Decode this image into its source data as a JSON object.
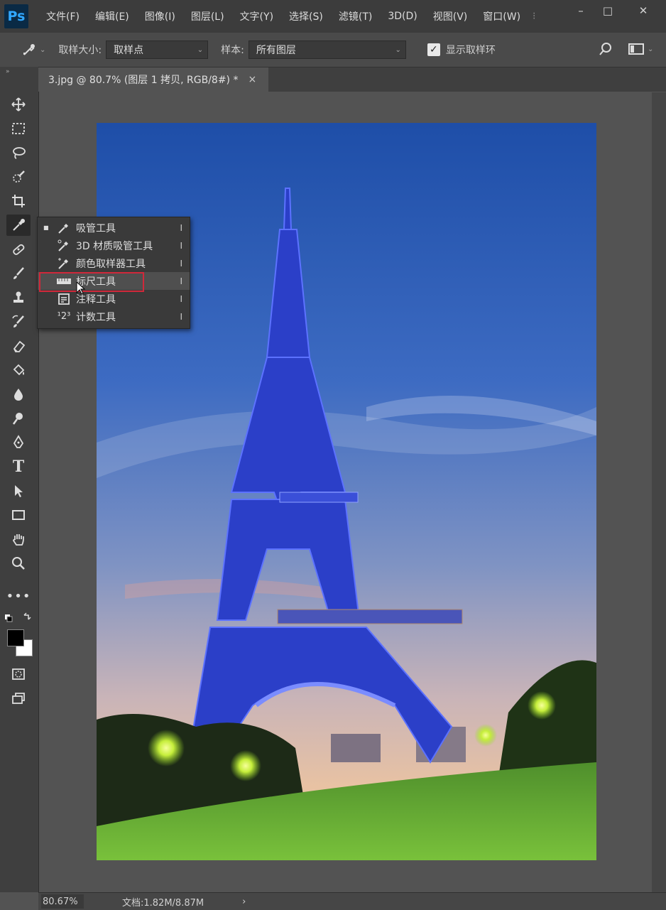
{
  "app": {
    "logo": "Ps"
  },
  "menu": [
    "文件(F)",
    "编辑(E)",
    "图像(I)",
    "图层(L)",
    "文字(Y)",
    "选择(S)",
    "滤镜(T)",
    "3D(D)",
    "视图(V)",
    "窗口(W)"
  ],
  "window_controls": {
    "minimize": "–",
    "maximize": "□",
    "close": "✕"
  },
  "options": {
    "sample_size_label": "取样大小:",
    "sample_size_value": "取样点",
    "sample_label": "样本:",
    "sample_value": "所有图层",
    "show_ring_label": "显示取样环",
    "show_ring_checked": true
  },
  "document_tab": {
    "title": "3.jpg @ 80.7% (图层 1 拷贝, RGB/8#) *",
    "close": "×"
  },
  "flyout": {
    "items": [
      {
        "label": "吸管工具",
        "key": "I",
        "icon": "eyedropper-icon",
        "selected": true
      },
      {
        "label": "3D 材质吸管工具",
        "key": "I",
        "icon": "3d-material-eyedropper-icon",
        "selected": false
      },
      {
        "label": "颜色取样器工具",
        "key": "I",
        "icon": "color-sampler-icon",
        "selected": false
      },
      {
        "label": "标尺工具",
        "key": "I",
        "icon": "ruler-icon",
        "selected": false
      },
      {
        "label": "注释工具",
        "key": "I",
        "icon": "note-icon",
        "selected": false
      },
      {
        "label": "计数工具",
        "key": "I",
        "icon": "count-icon",
        "selected": false
      }
    ],
    "hovered_index": 3
  },
  "status": {
    "zoom": "80.67%",
    "doc_info": "文档:1.82M/8.87M",
    "arrow": "›"
  },
  "colors": {
    "foreground": "#000000",
    "background": "#ffffff",
    "highlight": "#d0283a"
  }
}
